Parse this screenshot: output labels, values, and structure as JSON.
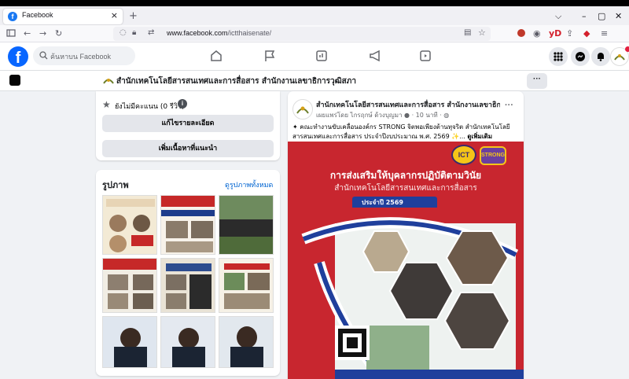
{
  "browser": {
    "tab_title": "Facebook",
    "tab_close": "×",
    "new_tab": "+",
    "url_host": "www.facebook.com",
    "url_path": "/ictthaisenate/",
    "window_min": "–",
    "window_max": "▢",
    "window_close": "✕",
    "tab_list": "⌵"
  },
  "facebook": {
    "search_placeholder": "ค้นหาบน Facebook",
    "logo": "f"
  },
  "page": {
    "title": "สำนักเทคโนโลยีสารสนเทศและการสื่อสาร สำนักงานเลขาธิการวุฒิสภา",
    "more": "···"
  },
  "intro": {
    "rating_text": "ยังไม่มีคะแนน (0 รีวิว)",
    "edit_details": "แก้ไขรายละเอียด",
    "add_featured": "เพิ่มเนื้อหาที่แนะนำ"
  },
  "photos": {
    "heading": "รูปภาพ",
    "see_all": "ดูรูปภาพทั้งหมด"
  },
  "post": {
    "author": "สำนักเทคโนโลยีสารสนเทศและการสื่อสาร สำนักงานเลขาธิการวุฒิสภา",
    "byline": "เผยแพร่โดย ไกรฤกษ์ ด้วงบุญมา",
    "time": "· 10 นาที ·",
    "text": "คณะทำงานขับเคลื่อนองค์กร STRONG จิตพอเพียงต้านทุจริต สำนักเทคโนโลยีสารสนเทศและการสื่อสาร ประจำปีงบประมาณ พ.ศ. 2569",
    "see_more": "ดูเพิ่มเติม",
    "more": "···",
    "poster_title": "การส่งเสริมให้บุคลากรปฏิบัติตามวินัย",
    "poster_subtitle": "สำนักเทคโนโลยีสารสนเทศและการสื่อสาร",
    "poster_year": "ประจำปี 2569",
    "badge_ict": "ICT",
    "badge_strong": "STRONG"
  },
  "colors": {
    "fb_blue": "#0866ff",
    "poster_red": "#c8262f",
    "page_bg": "#f0f2f5"
  }
}
